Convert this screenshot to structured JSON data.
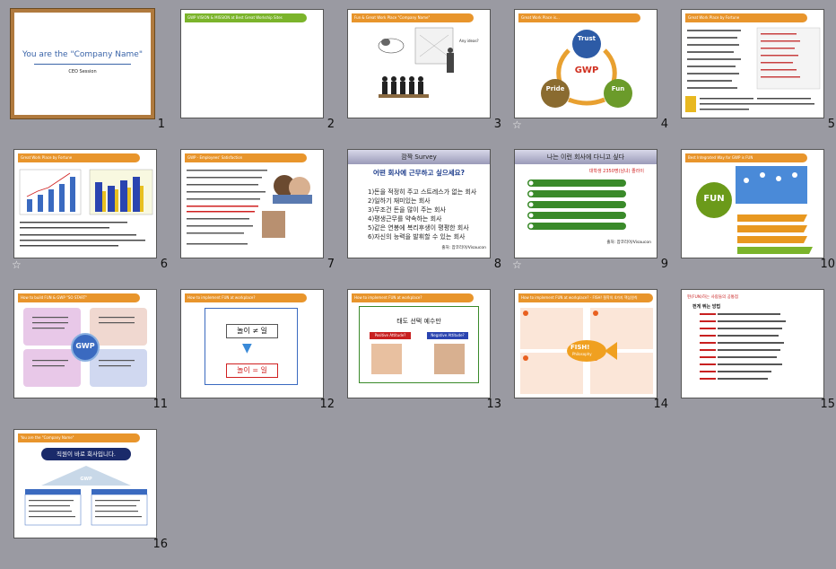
{
  "colors": {
    "background": "#9a9aa2",
    "selected_border": "#b07a3e",
    "banner_green": "#7bb42b",
    "banner_orange": "#e8952c"
  },
  "slides": [
    {
      "num": "1",
      "title": "You are the \"Company Name\"",
      "subtitle": "CEO Session"
    },
    {
      "num": "2",
      "banner": "GWP VISION & MISSION at Best Great Workship Sites"
    },
    {
      "num": "3",
      "banner": "Fun & Great Work Place \"Company Name\"",
      "caption": "Any ideas?"
    },
    {
      "num": "4",
      "banner": "Great Work Place is...",
      "center": "GWP",
      "trust": "Trust",
      "pride": "Pride",
      "fun": "Fun"
    },
    {
      "num": "5",
      "banner": "Great Work Place by Fortune"
    },
    {
      "num": "6",
      "banner": "Great Work Place by Fortune"
    },
    {
      "num": "7",
      "banner": "GWP - Employees' Satisfaction"
    },
    {
      "num": "8",
      "title": "깜짝 Survey",
      "question": "어떤 회사에 근무하고 싶으세요?",
      "items": [
        "1)돈을 적정히 주고 스트레스가 없는 회사",
        "2)일하기 재미있는 회사",
        "3)무조건 돈을 많이 주는 회사",
        "4)평생근무를 약속하는 회사",
        "5)같은 연봉에 복리후생이 평평한 회사",
        "6)자신의 능력을 발휘할 수 있는 회사"
      ],
      "source": "출처: 잡코리아/Visaucon"
    },
    {
      "num": "9",
      "title": "나는 이런 회사에 다니고 싶다",
      "subtitle": "대학생 2350명(남녀) 졸라이",
      "source": "출처: 잡코리아/Visaucon"
    },
    {
      "num": "10",
      "banner": "Best Integrated Way for GWP is FUN",
      "fun": "FUN"
    },
    {
      "num": "11",
      "banner": "How to build FUN & GWP \"SO START\"",
      "center": "GWP"
    },
    {
      "num": "12",
      "banner": "How to implement FUN at workplace?",
      "line1": "놀이 ≠ 일",
      "line2": "놀이 = 일"
    },
    {
      "num": "13",
      "banner": "How to implement FUN at workplace?",
      "title": "태도 선택 예수만",
      "pos": "Positive Attitude?",
      "neg": "Negative Attitude?"
    },
    {
      "num": "14",
      "banner": "How to implement FUN at workplace? - FISH! 철학의 4가지 핵심원칙",
      "fish": "FISH!",
      "phil": "Philosophy"
    },
    {
      "num": "15",
      "title": "펀(FUN)하는 사람들의 공통점",
      "subtitle": "펀게 뛰는 방법"
    },
    {
      "num": "16",
      "banner": "You are the \"Company Name\"",
      "title": "직원이 바로 회사입니다.",
      "center": "GWP"
    }
  ]
}
